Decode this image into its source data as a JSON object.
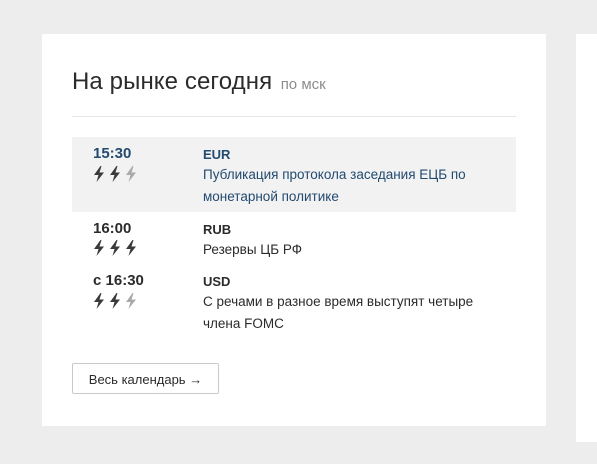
{
  "widget": {
    "title": "На рынке сегодня",
    "subtitle": "по мск"
  },
  "events": [
    {
      "time": "15:30",
      "importance": 2,
      "currency": "EUR",
      "description": "Публикация протокола заседания ЕЦБ по монетарной политике",
      "highlighted": true
    },
    {
      "time": "16:00",
      "importance": 3,
      "currency": "RUB",
      "description": "Резервы ЦБ РФ",
      "highlighted": false
    },
    {
      "time": "с 16:30",
      "importance": 2,
      "currency": "USD",
      "description": "С речами в разное время выступят четыре члена FOMC",
      "highlighted": false
    }
  ],
  "importance_max": 3,
  "icons": {
    "importance": "lightning-bolt-icon"
  },
  "colors": {
    "page_background": "#ededed",
    "card_background": "#ffffff",
    "highlight_row": "#f2f2f2",
    "highlight_text": "#234a70",
    "text": "#2b2b2b",
    "muted": "#8c8c8c",
    "bolt_active": "#3a3a3a",
    "bolt_inactive": "#a9a9a9"
  },
  "footer": {
    "calendar_button_label": "Весь календарь →"
  }
}
